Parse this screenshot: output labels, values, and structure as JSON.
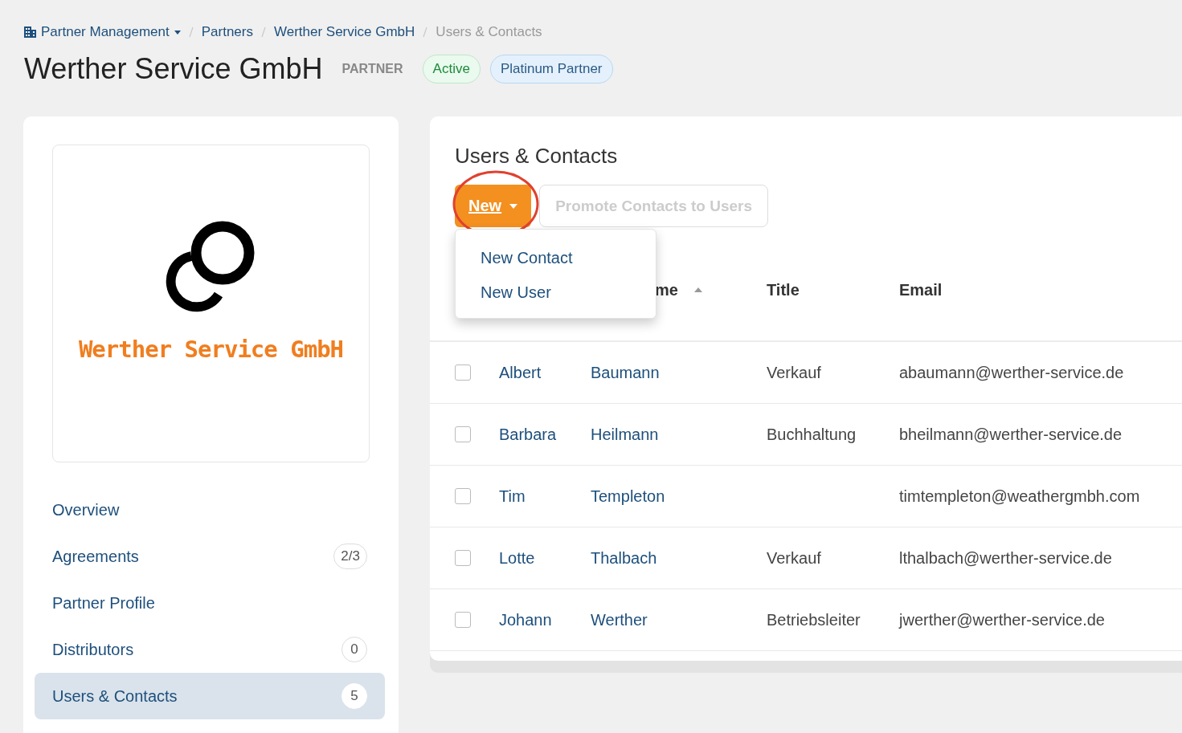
{
  "breadcrumb": [
    {
      "label": "Partner Management",
      "kind": "menu"
    },
    {
      "label": "Partners",
      "kind": "link"
    },
    {
      "label": "Werther Service GmbH",
      "kind": "link"
    },
    {
      "label": "Users & Contacts",
      "kind": "current"
    }
  ],
  "header": {
    "title": "Werther Service GmbH",
    "badges": [
      {
        "label": "PARTNER",
        "kind": "type"
      },
      {
        "label": "Active",
        "kind": "status"
      },
      {
        "label": "Platinum Partner",
        "kind": "tier"
      }
    ]
  },
  "sidebar": {
    "logo_text": "Werther Service GmbH",
    "items": [
      {
        "label": "Overview",
        "selected": false
      },
      {
        "label": "Agreements",
        "count": "2/3",
        "selected": false
      },
      {
        "label": "Partner Profile",
        "selected": false
      },
      {
        "label": "Distributors",
        "count": "0",
        "selected": false
      },
      {
        "label": "Users & Contacts",
        "count": "5",
        "selected": true
      }
    ]
  },
  "panel": {
    "title": "Users & Contacts",
    "new_button": {
      "label": "New",
      "highlighted": true
    },
    "promote_button": {
      "label": "Promote Contacts to Users",
      "disabled": true
    },
    "menu": [
      "New Contact",
      "New User"
    ],
    "table": {
      "columns": [
        {
          "label": "me",
          "sorted": true
        },
        {
          "label": "Title",
          "sorted": false
        },
        {
          "label": "Email",
          "sorted": false
        }
      ],
      "rows": [
        {
          "first": "Albert",
          "last": "Baumann",
          "title": "Verkauf",
          "email": "abaumann@werther-service.de",
          "checked": false
        },
        {
          "first": "Barbara",
          "last": "Heilmann",
          "title": "Buchhaltung",
          "email": "bheilmann@werther-service.de",
          "checked": false
        },
        {
          "first": "Tim",
          "last": "Templeton",
          "title": "",
          "email": "timtempleton@weathergmbh.com",
          "checked": false
        },
        {
          "first": "Lotte",
          "last": "Thalbach",
          "title": "Verkauf",
          "email": "lthalbach@werther-service.de",
          "checked": false
        },
        {
          "first": "Johann",
          "last": "Werther",
          "title": "Betriebsleiter",
          "email": "jwerther@werther-service.de",
          "checked": false
        }
      ]
    }
  }
}
